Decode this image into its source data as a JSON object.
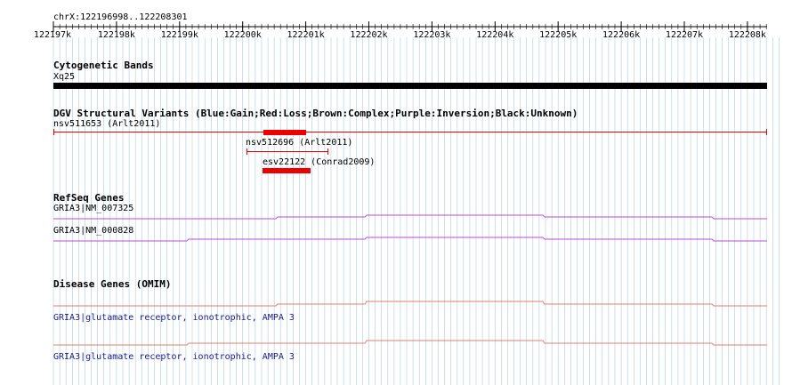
{
  "ruler": {
    "range_label": "chrX:122196998..122208301",
    "ticks": [
      "122197k",
      "122198k",
      "122199k",
      "122200k",
      "122201k",
      "122202k",
      "122203k",
      "122204k",
      "122205k",
      "122206k",
      "122207k",
      "122208k"
    ]
  },
  "cytoband": {
    "title": "Cytogenetic Bands",
    "band": "Xq25"
  },
  "dgv": {
    "title": "DGV Structural Variants (Blue:Gain;Red:Loss;Brown:Complex;Purple:Inversion;Black:Unknown)",
    "variants": [
      {
        "label": "nsv511653 (Arlt2011)",
        "color": "#ee0000"
      },
      {
        "label": "nsv512696 (Arlt2011)",
        "color": "#ee0000"
      },
      {
        "label": "esv22122 (Conrad2009)",
        "color": "#ee0000"
      }
    ]
  },
  "refseq": {
    "title": "RefSeq Genes",
    "genes": [
      {
        "label": "GRIA3|NM_007325",
        "color": "#b94fd6"
      },
      {
        "label": "GRIA3|NM_000828",
        "color": "#b94fd6"
      }
    ]
  },
  "omim": {
    "title": "Disease Genes (OMIM)",
    "genes": [
      {
        "label": "GRIA3|glutamate receptor, ionotrophic, AMPA 3",
        "color": "#e0826a"
      },
      {
        "label": "GRIA3|glutamate receptor, ionotrophic, AMPA 3",
        "color": "#e0826a"
      }
    ]
  },
  "colors": {
    "grid": "#aaccdd",
    "loss": "#ee0000",
    "refseq": "#b94fd6",
    "omim": "#e0826a",
    "omim_text": "#1a1a8c"
  }
}
